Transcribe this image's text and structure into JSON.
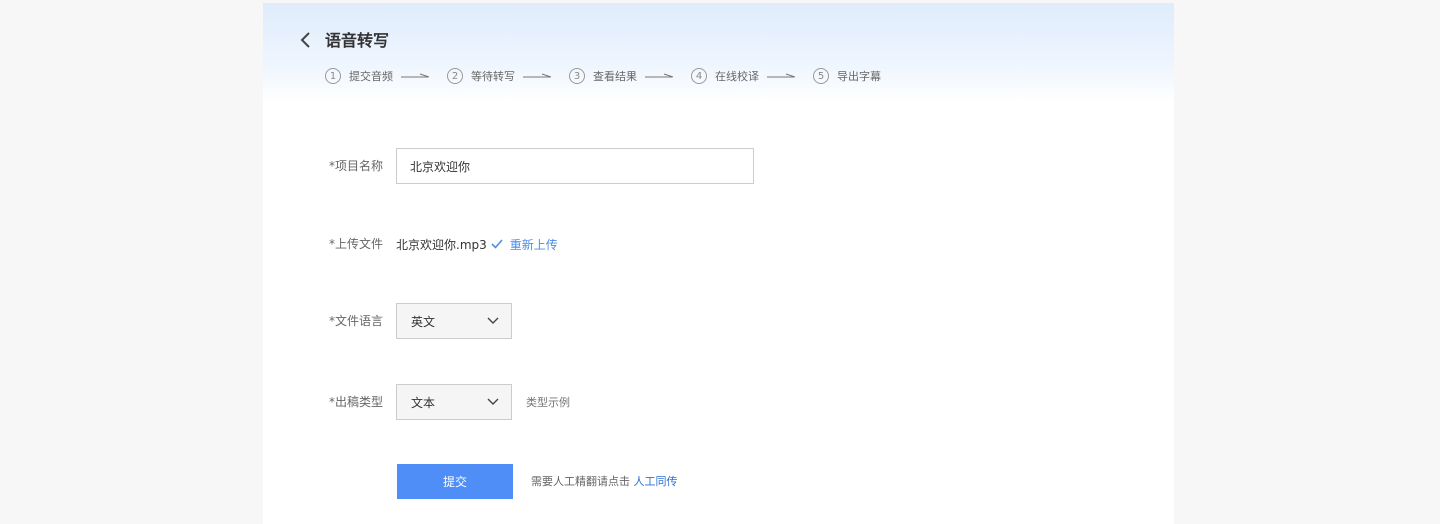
{
  "header": {
    "title": "语音转写",
    "steps": [
      {
        "num": "1",
        "label": "提交音频"
      },
      {
        "num": "2",
        "label": "等待转写"
      },
      {
        "num": "3",
        "label": "查看结果"
      },
      {
        "num": "4",
        "label": "在线校译"
      },
      {
        "num": "5",
        "label": "导出字幕"
      }
    ]
  },
  "form": {
    "project_name": {
      "label": "*项目名称",
      "value": "北京欢迎你"
    },
    "upload_file": {
      "label": "*上传文件",
      "file_name": "北京欢迎你.mp3",
      "reupload_label": "重新上传"
    },
    "file_language": {
      "label": "*文件语言",
      "selected": "英文"
    },
    "output_type": {
      "label": "*出稿类型",
      "selected": "文本",
      "hint": "类型示例"
    }
  },
  "footer": {
    "submit_label": "提交",
    "note": "需要人工精翻请点击",
    "link_label": "人工同传"
  },
  "colors": {
    "accent": "#4f8ef6",
    "link": "#4a8ee8",
    "header_gradient_top": "#dfecfc"
  }
}
